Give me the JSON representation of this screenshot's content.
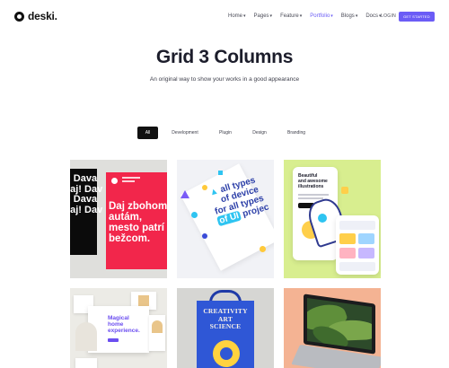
{
  "header": {
    "logo_text": "deski.",
    "nav": [
      {
        "label": "Home",
        "active": false
      },
      {
        "label": "Pages",
        "active": false
      },
      {
        "label": "Feature",
        "active": false
      },
      {
        "label": "Portfolio",
        "active": true
      },
      {
        "label": "Blogs",
        "active": false
      },
      {
        "label": "Docs",
        "active": false
      }
    ],
    "login_label": "LOGIN",
    "cta_label": "GET STARTED"
  },
  "hero": {
    "title": "Grid 3 Columns",
    "subtitle": "An original way to show your works in a good appearance"
  },
  "filters": [
    {
      "label": "All",
      "active": true
    },
    {
      "label": "Development",
      "active": false
    },
    {
      "label": "Plugin",
      "active": false
    },
    {
      "label": "Design",
      "active": false
    },
    {
      "label": "Branding",
      "active": false
    }
  ],
  "portfolio": {
    "card1": {
      "left_lines": [
        "j! Dava",
        "vaj! Dav",
        "j! Dava",
        "vaj! Dav"
      ],
      "poster_lines": [
        "Daj zbohom",
        "autám,",
        "mesto patrí",
        "bežcom."
      ]
    },
    "card2": {
      "lines": [
        "all types",
        "of device",
        "for all",
        "types",
        "of UI",
        "projec"
      ]
    },
    "card3": {
      "headline_lines": [
        "Beautiful",
        "and awesome",
        "illustrations"
      ]
    },
    "card4": {
      "headline_lines": [
        "Magical",
        "home",
        "experience."
      ]
    },
    "card5": {
      "bag_lines": [
        "CREATIVITY",
        "ART",
        "SCIENCE"
      ]
    }
  },
  "colors": {
    "accent": "#6b5cf6",
    "poster_red": "#f2264b",
    "lime": "#d8ee8f",
    "peach": "#f4b393"
  }
}
